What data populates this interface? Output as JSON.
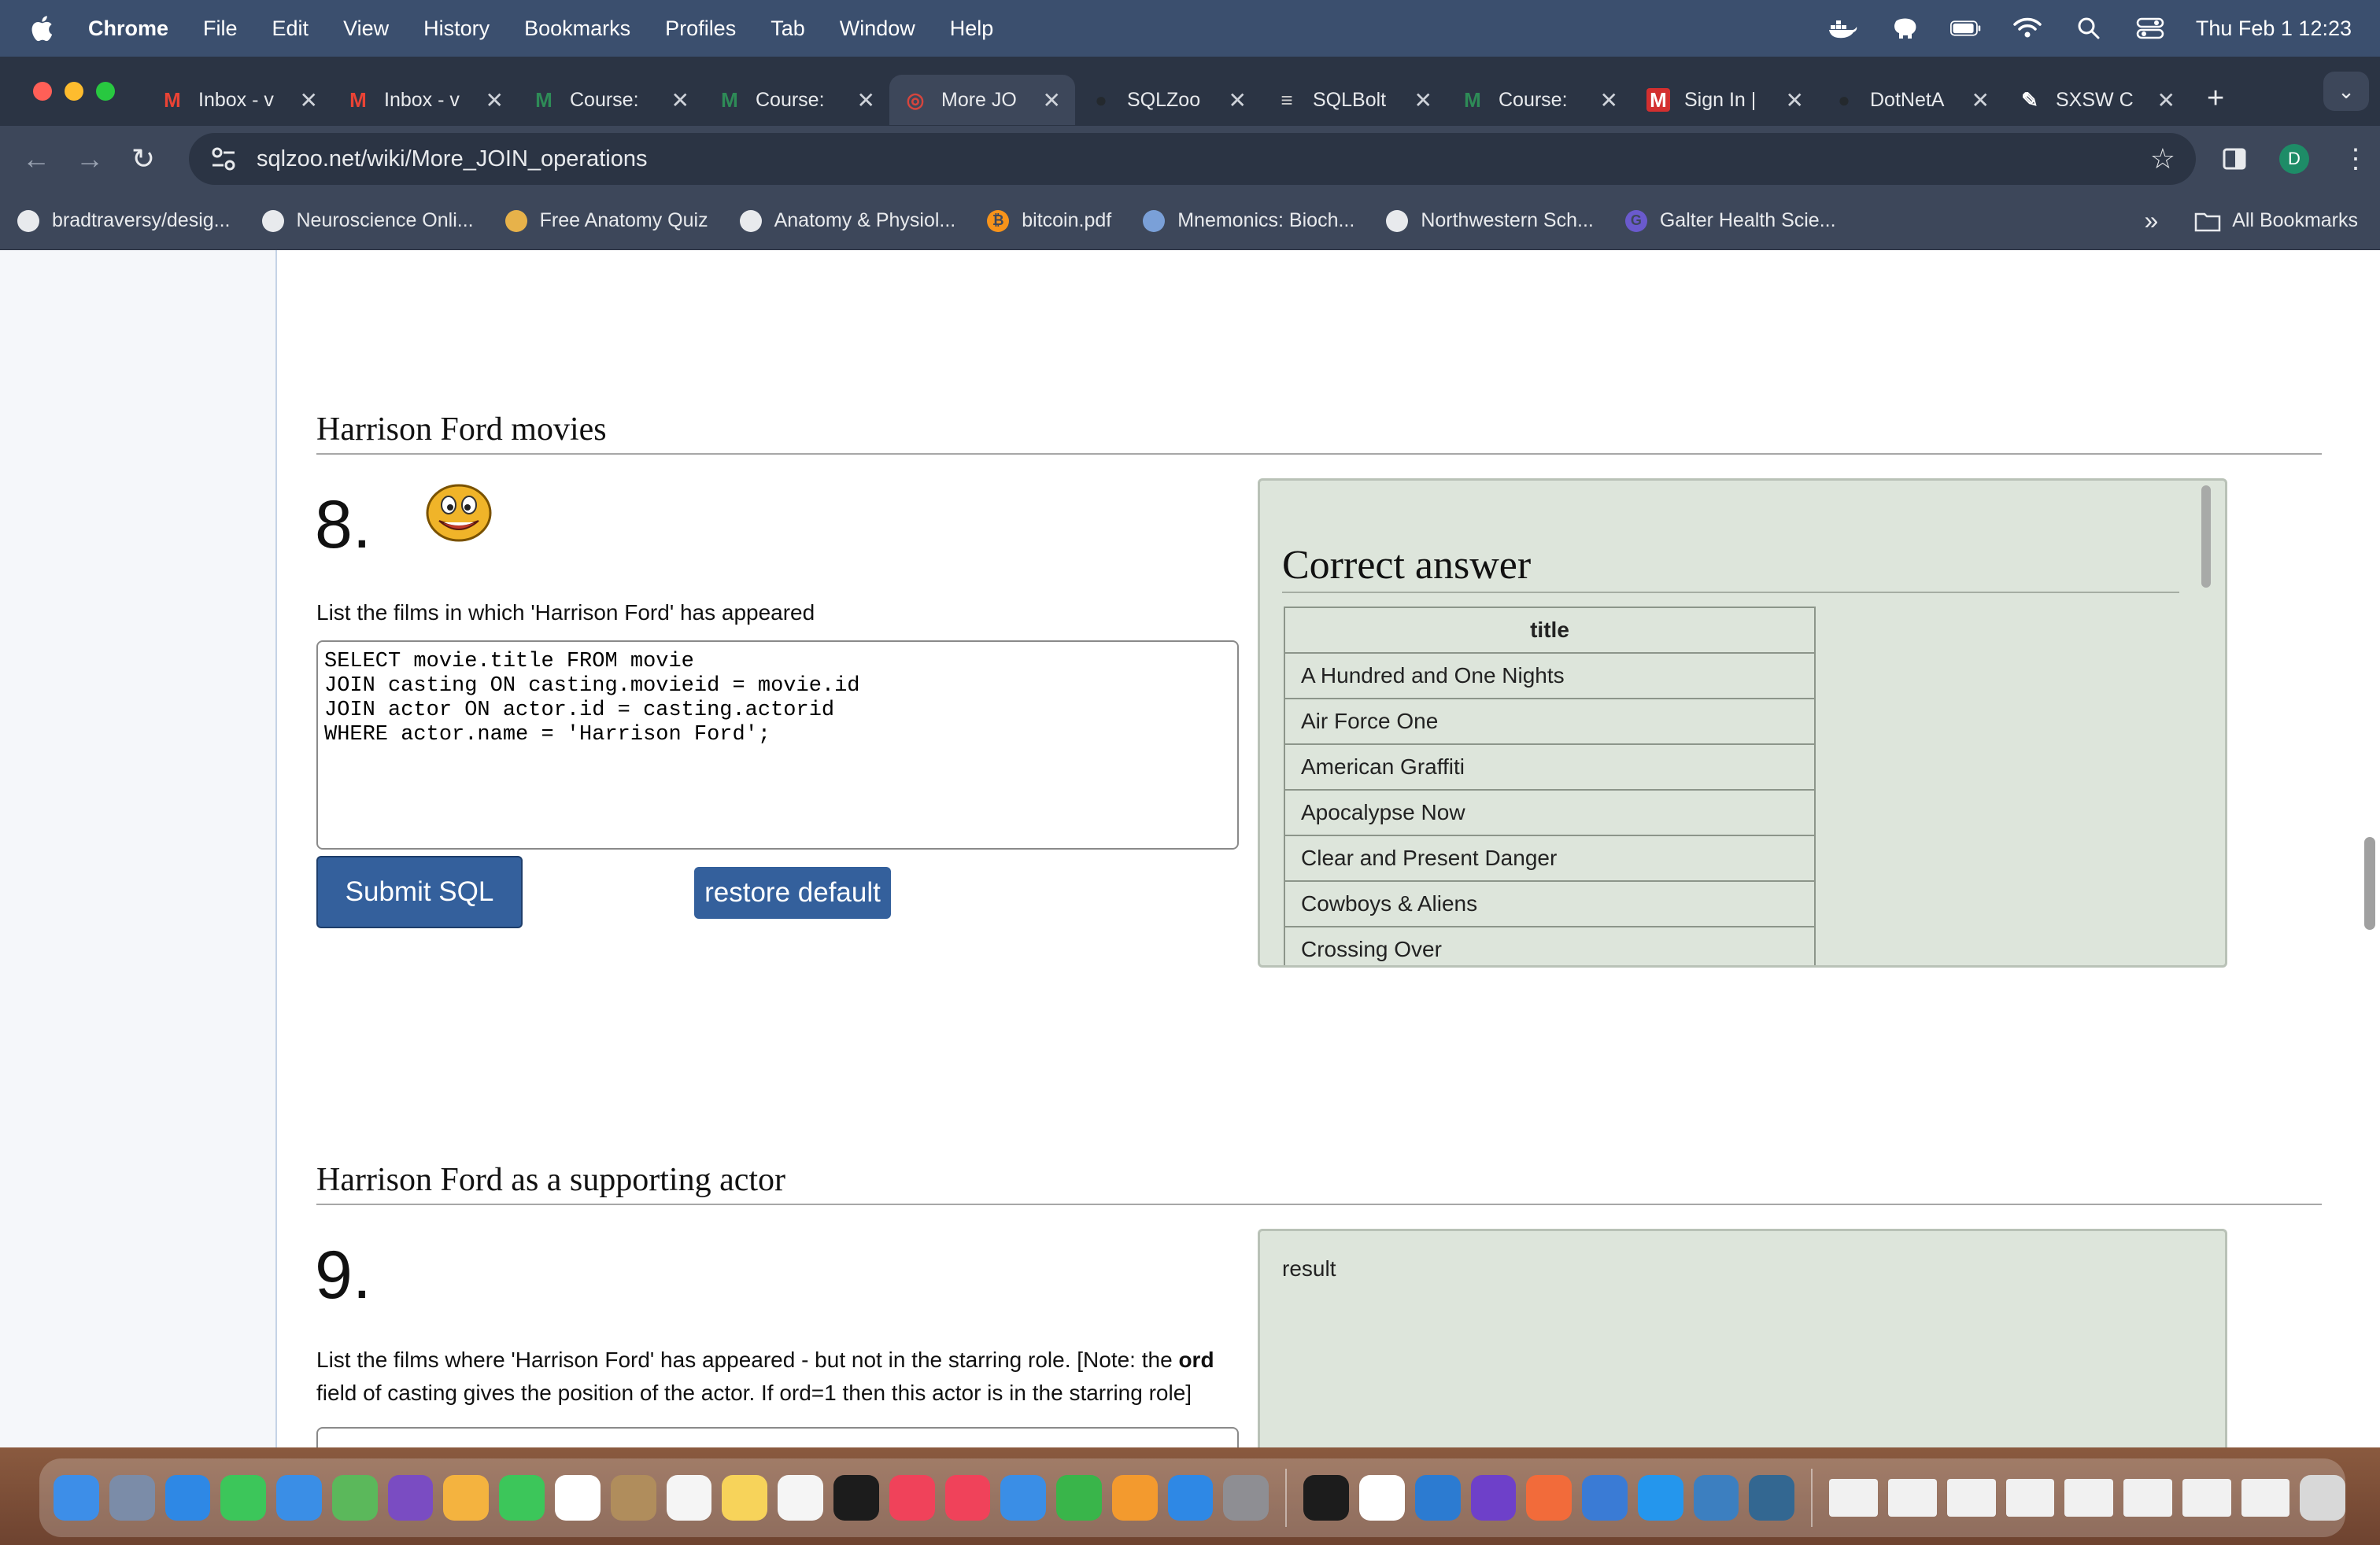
{
  "menubar": {
    "app": "Chrome",
    "items": [
      "File",
      "Edit",
      "View",
      "History",
      "Bookmarks",
      "Profiles",
      "Tab",
      "Window",
      "Help"
    ],
    "datetime": "Thu Feb 1  12:23"
  },
  "tabs": [
    {
      "title": "Inbox - v",
      "icon": "gmail-icon",
      "color": "#ea4335"
    },
    {
      "title": "Inbox - v",
      "icon": "gmail-icon",
      "color": "#ea4335"
    },
    {
      "title": "Course:",
      "icon": "m-icon",
      "color": "#2e8b57"
    },
    {
      "title": "Course:",
      "icon": "m-icon",
      "color": "#2e8b57"
    },
    {
      "title": "More JO",
      "icon": "sqlzoo-icon",
      "color": "#d6453d",
      "active": true
    },
    {
      "title": "SQLZoo",
      "icon": "github-icon",
      "color": "#24292e"
    },
    {
      "title": "SQLBolt",
      "icon": "database-icon",
      "color": "#cccccc"
    },
    {
      "title": "Course:",
      "icon": "m-icon",
      "color": "#2e8b57"
    },
    {
      "title": "Sign In |",
      "icon": "m-logo-icon",
      "color": "#d32f2f"
    },
    {
      "title": "DotNetA",
      "icon": "github-icon",
      "color": "#24292e"
    },
    {
      "title": "SXSW C",
      "icon": "edit-icon",
      "color": "#ffffff"
    }
  ],
  "url": "sqlzoo.net/wiki/More_JOIN_operations",
  "profile_initial": "D",
  "bookmarks": [
    {
      "label": "bradtraversy/desig...",
      "icon": "github-icon"
    },
    {
      "label": "Neuroscience Onli...",
      "icon": "globe-icon"
    },
    {
      "label": "Free Anatomy Quiz",
      "icon": "quiz-icon"
    },
    {
      "label": "Anatomy & Physiol...",
      "icon": "globe-icon"
    },
    {
      "label": "bitcoin.pdf",
      "icon": "bitcoin-icon"
    },
    {
      "label": "Mnemonics: Bioch...",
      "icon": "mnemonic-icon"
    },
    {
      "label": "Northwestern Sch...",
      "icon": "globe-icon"
    },
    {
      "label": "Galter Health Scie...",
      "icon": "g-icon"
    }
  ],
  "all_bookmarks_label": "All Bookmarks",
  "q8": {
    "section_title": "Harrison Ford movies",
    "number": "8.",
    "question": "List the films in which 'Harrison Ford' has appeared",
    "sql": "SELECT movie.title FROM movie\nJOIN casting ON casting.movieid = movie.id\nJOIN actor ON actor.id = casting.actorid\nWHERE actor.name = 'Harrison Ford';",
    "submit_label": "Submit SQL",
    "restore_label": "restore default",
    "answer_title": "Correct answer",
    "answer_header": "title",
    "answer_rows": [
      "A Hundred and One Nights",
      "Air Force One",
      "American Graffiti",
      "Apocalypse Now",
      "Clear and Present Danger",
      "Cowboys & Aliens",
      "Crossing Over"
    ]
  },
  "q9": {
    "section_title": "Harrison Ford as a supporting actor",
    "number": "9.",
    "question_part1": "List the films where 'Harrison Ford' has appeared - but not in the starring role. [Note: the ",
    "question_bold": "ord",
    "question_part2": "field of casting gives the position of the actor. If ord=1 then this actor is in the starring role]",
    "result_label": "result"
  }
}
